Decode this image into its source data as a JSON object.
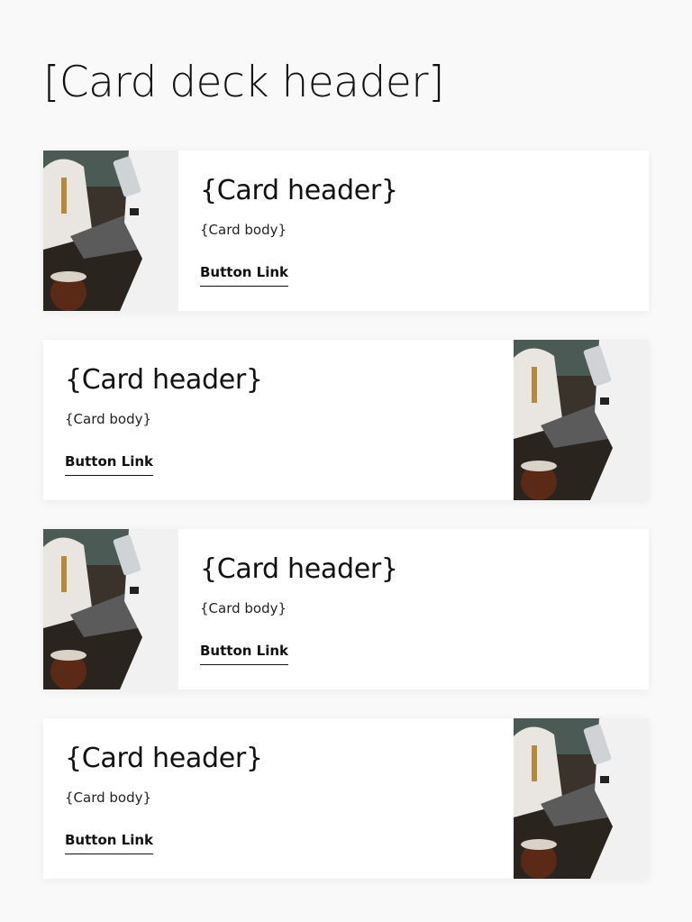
{
  "deck": {
    "header": "[Card deck header]"
  },
  "cards": [
    {
      "header": "{Card header}",
      "body": "{Card body}",
      "link": "Button Link",
      "image_position": "left",
      "image_icon": "photo-people-with-devices"
    },
    {
      "header": "{Card header}",
      "body": "{Card body}",
      "link": "Button Link",
      "image_position": "right",
      "image_icon": "photo-people-with-devices"
    },
    {
      "header": "{Card header}",
      "body": "{Card body}",
      "link": "Button Link",
      "image_position": "left",
      "image_icon": "photo-people-with-devices"
    },
    {
      "header": "{Card header}",
      "body": "{Card body}",
      "link": "Button Link",
      "image_position": "right",
      "image_icon": "photo-people-with-devices"
    }
  ],
  "colors": {
    "page_background": "#f9f9f9",
    "card_background": "#ffffff",
    "text": "#111111"
  }
}
